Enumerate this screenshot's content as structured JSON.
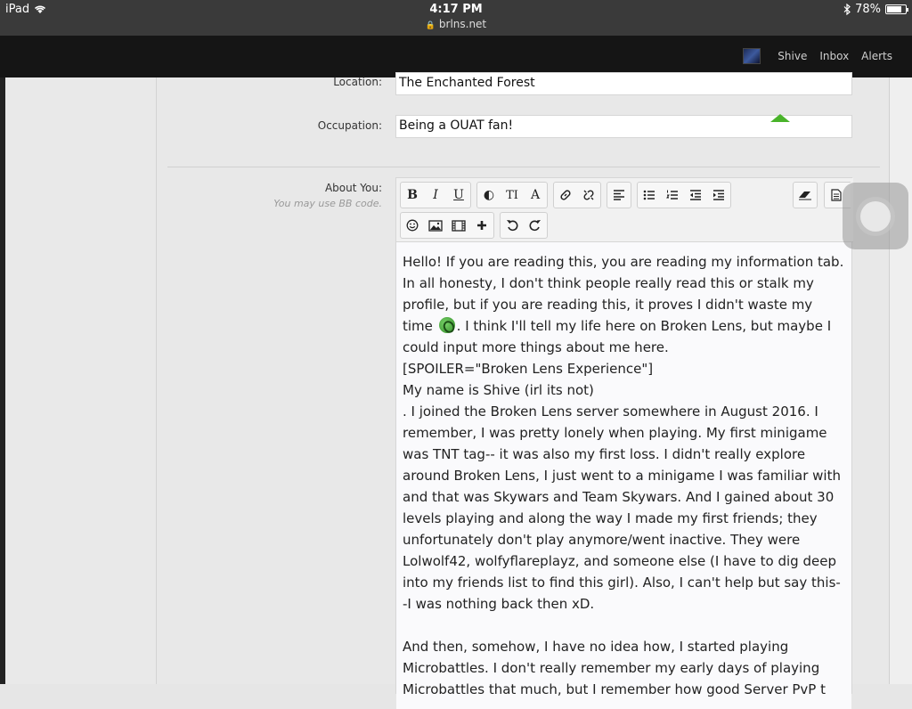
{
  "statusbar": {
    "device": "iPad",
    "time": "4:17 PM",
    "url": "brlns.net",
    "battery": "78%",
    "battery_level": 0.78
  },
  "nav": {
    "items": [
      "Shive",
      "Inbox",
      "Alerts"
    ]
  },
  "form": {
    "location_label": "Location:",
    "location_value": "The Enchanted Forest",
    "occupation_label": "Occupation:",
    "occupation_value": "Being a OUAT fan!",
    "about_label": "About You:",
    "about_hint": "You may use BB code."
  },
  "toolbar": {
    "row1": [
      "B",
      "I",
      "U",
      "◐",
      "TI",
      "A",
      "link",
      "unlink",
      "align-left",
      "bullets",
      "numbers",
      "outdent",
      "indent"
    ],
    "row2": [
      "smiley",
      "image",
      "media",
      "insert",
      "undo",
      "redo"
    ]
  },
  "about": {
    "p1a": "Hello! If you are reading this, you are reading my information tab. In all honesty, I don't think people really read this or stalk my profile, but if you are reading this, it proves I didn't waste my time ",
    "p1b": ". I think I'll tell my life here on Broken Lens, but maybe I could input more things about me here.",
    "p2": "[SPOILER=\"Broken Lens Experience\"]",
    "p3": "My name is Shive (irl its not)",
    "p4": ". I joined the Broken Lens server somewhere in August 2016. I remember, I was pretty lonely when playing. My first minigame was TNT tag-- it was also my first loss. I didn't really explore around Broken Lens, I just went to a minigame I was familiar with and that was Skywars and Team Skywars. And I gained about 30 levels playing and along the way I made my first friends; they unfortunately don't play anymore/went inactive. They were Lolwolf42, wolfyflareplayz, and someone else (I have to dig deep into my friends list to find this girl). Also, I can't help but say this--I was nothing back then xD.",
    "p5": "And then, somehow, I have no idea how, I started playing Microbattles. I don't really remember my early days of playing Microbattles that much, but I remember how good Server PvP t"
  }
}
